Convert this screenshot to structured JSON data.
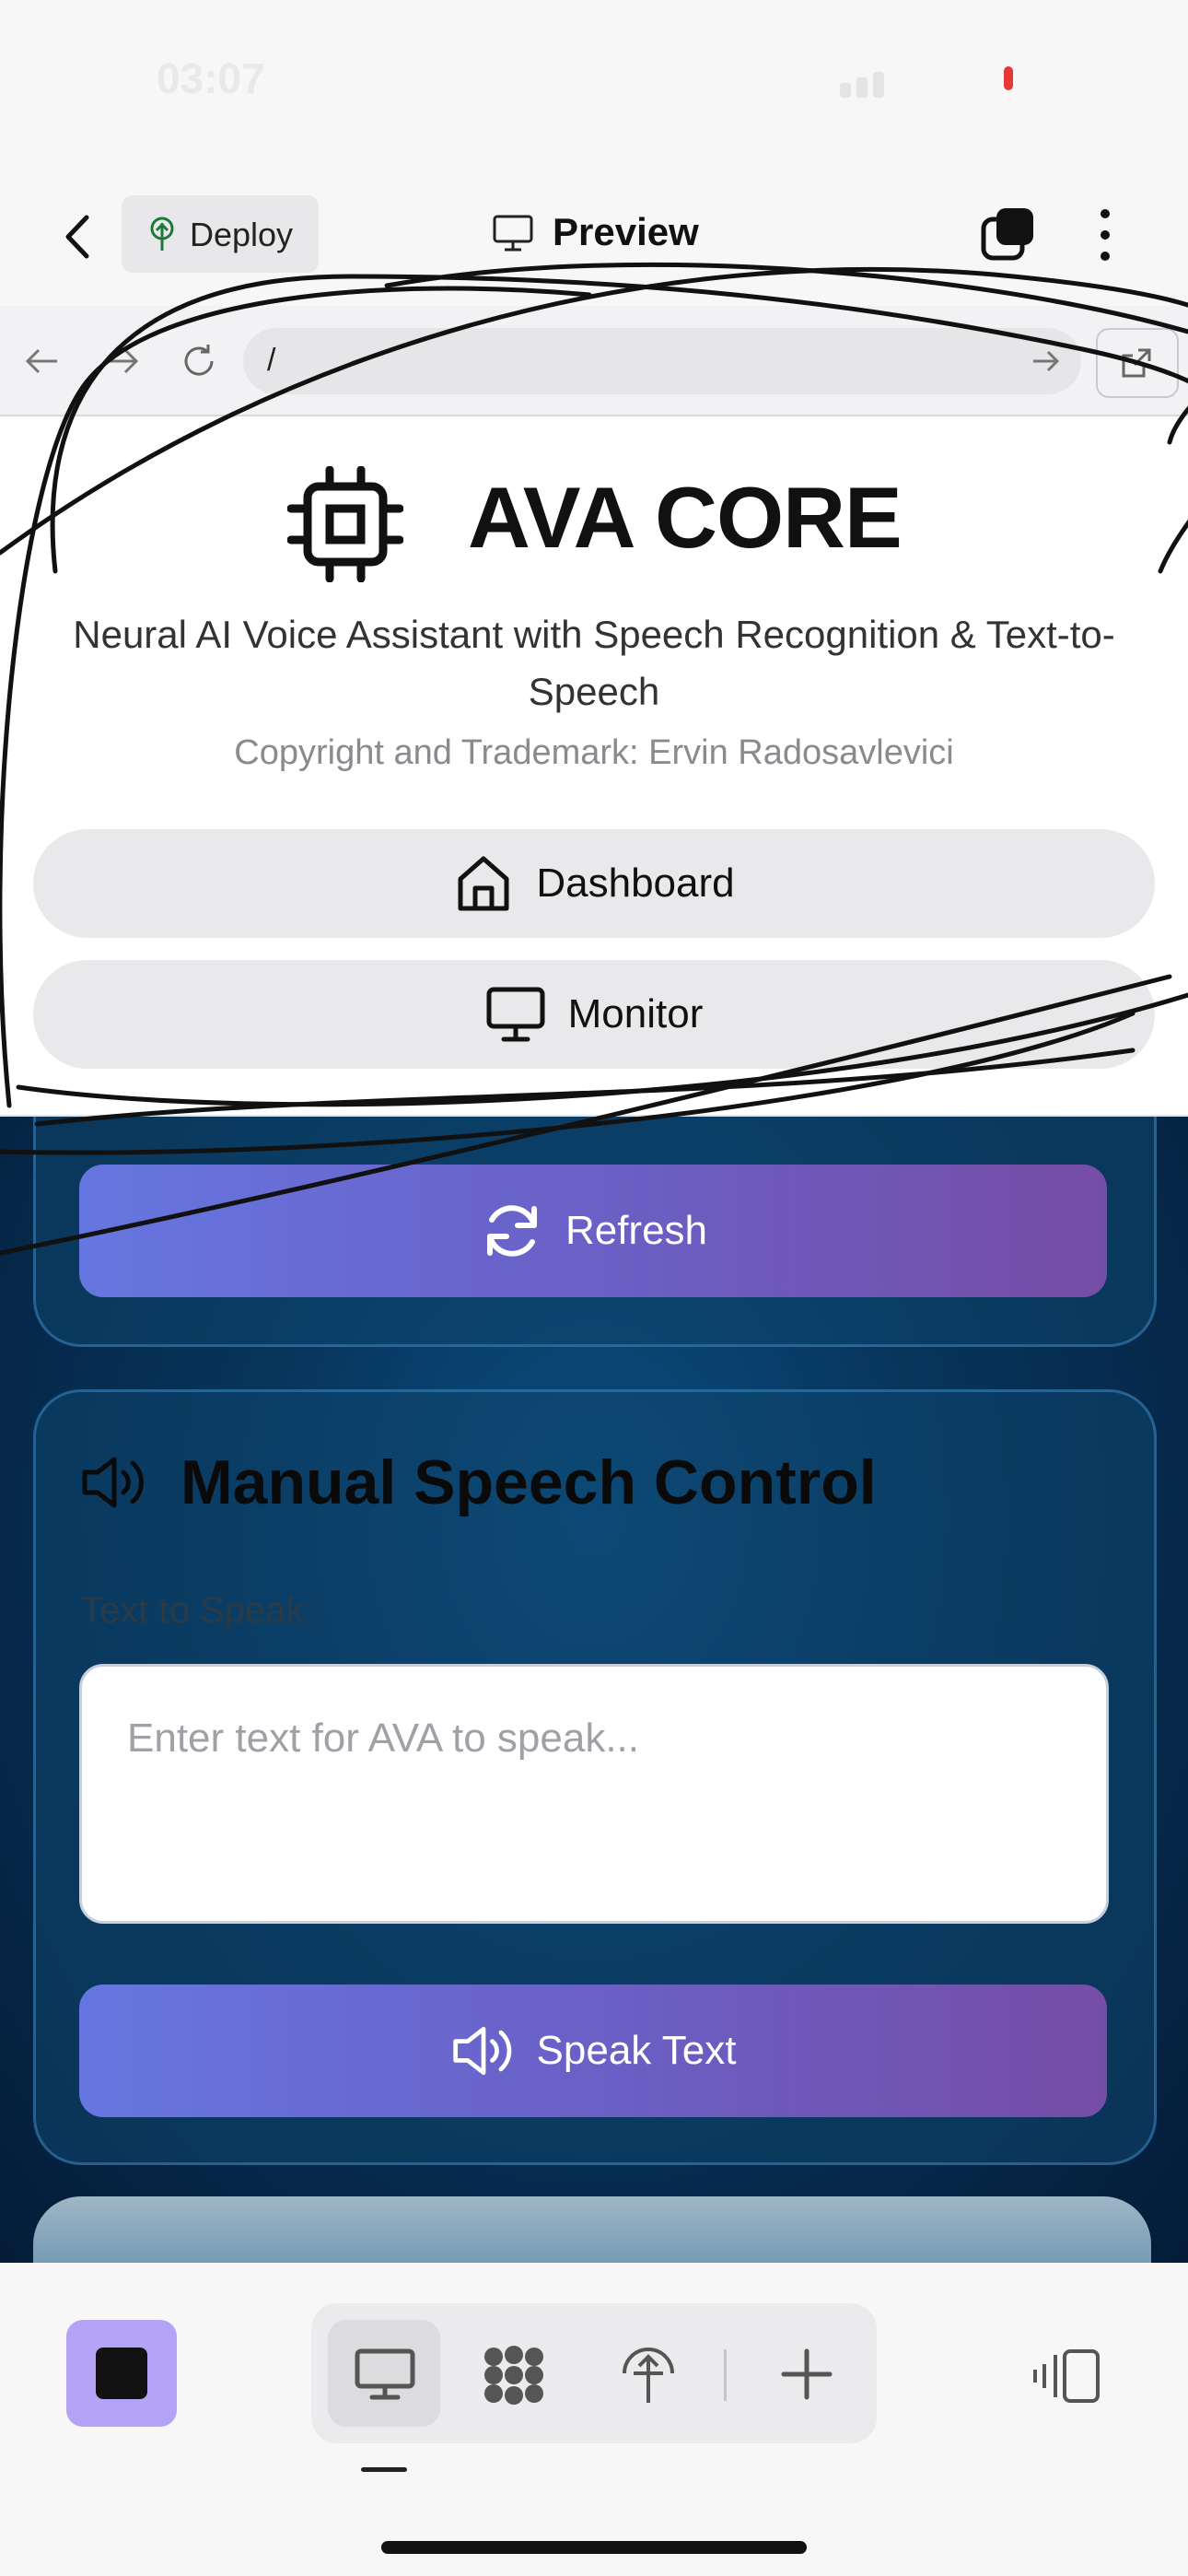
{
  "status_bar": {
    "time": "03:07"
  },
  "app_header": {
    "back_icon": "chevron-left-icon",
    "deploy_label": "Deploy",
    "preview_label": "Preview",
    "tabs_icon": "tabs-icon",
    "more_icon": "more-vertical-icon"
  },
  "browser": {
    "url": "/"
  },
  "header": {
    "title": "AVA CORE",
    "subtitle": "Neural AI Voice Assistant with Speech Recognition & Text-to-Speech",
    "copyright": "Copyright and Trademark: Ervin Radosavlevici",
    "nav": [
      {
        "label": "Dashboard",
        "icon": "home-icon"
      },
      {
        "label": "Monitor",
        "icon": "monitor-icon"
      }
    ]
  },
  "main": {
    "refresh_label": "Refresh",
    "manual_speech": {
      "title": "Manual Speech Control",
      "field_label": "Text to Speak:",
      "placeholder": "Enter text for AVA to speak...",
      "speak_label": "Speak Text"
    }
  },
  "toolbar": {
    "items": [
      "stop-icon",
      "preview-icon",
      "apps-icon",
      "deploy-icon",
      "add-icon",
      "panel-icon"
    ]
  },
  "colors": {
    "accent_start": "#6676e0",
    "accent_end": "#764da6",
    "stop_button": "#b4a3f7",
    "dark_background": "#07355c"
  }
}
